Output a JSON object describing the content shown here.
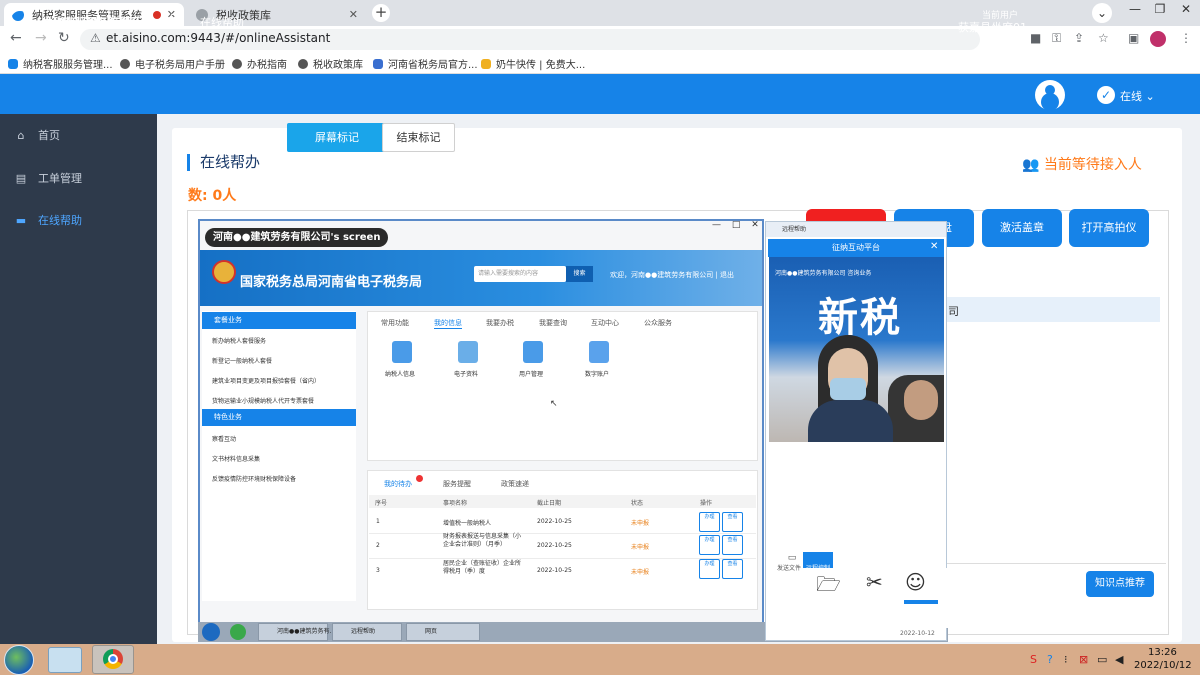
{
  "browser": {
    "tabs": [
      {
        "label": "纳税客服服务管理系统",
        "active": true
      },
      {
        "label": "税收政策库",
        "active": false
      }
    ],
    "url": "et.aisino.com:9443/#/onlineAssistant",
    "bookmarks": [
      "纳税客服服务管理...",
      "电子税务局用户手册",
      "办税指南",
      "税收政策库",
      "河南省税务局官方...",
      "奶牛快传 | 免费大..."
    ]
  },
  "app": {
    "title": "纳税客服服务管理系统",
    "breadcrumb": "在线帮助",
    "current_user_label": "当前用户",
    "current_user": "获嘉县坐席01",
    "status": "在线",
    "accent": "#1683e8"
  },
  "sidebar": {
    "items": [
      {
        "label": "首页",
        "icon": "home-icon",
        "active": false
      },
      {
        "label": "工单管理",
        "icon": "clipboard-icon",
        "active": false
      },
      {
        "label": "在线帮助",
        "icon": "chat-icon",
        "active": true
      }
    ]
  },
  "main": {
    "btn_mark": "屏幕标记",
    "btn_end_mark": "结束标记",
    "section_title": "在线帮办",
    "waiting_label": "当前等待接入人",
    "waiting_count": "数: 0人",
    "actions": [
      "激活盖章",
      "打开高拍仪"
    ],
    "action_partial": "盘",
    "right_list_item": "司",
    "knowledge_btn": "知识点推荐"
  },
  "shared_screen": {
    "title": "河南●●建筑劳务有限公司's screen",
    "window_buttons": "— □ ✕",
    "portal_title": "国家税务总局河南省电子税务局",
    "search_placeholder": "请输入需要搜索的内容",
    "search_button": "搜索",
    "welcome": "欢迎，河南●●建筑劳务有限公司 | 退出",
    "left_menu": {
      "group1": "套餐业务",
      "group1_items": [
        "新办纳税人套餐服务",
        "新登记一般纳税人套餐",
        "建筑业项目变更及项目报验套餐（省内）",
        "货物运输业小规模纳税人代开专票套餐"
      ],
      "group2": "特色业务",
      "group2_items": [
        "察看互动",
        "文书材料信息采集",
        "反馈疫情防控环境财税保障设备"
      ]
    },
    "tabs": [
      "常用功能",
      "我的信息",
      "我要办税",
      "我要查询",
      "互动中心",
      "公众服务"
    ],
    "services": [
      "纳税人信息",
      "电子资料",
      "用户管理",
      "数字账户"
    ],
    "todo_tabs": [
      "我的待办",
      "服务提醒",
      "政策速递"
    ],
    "table": {
      "headers": [
        "序号",
        "事项名称",
        "截止日期",
        "状态",
        "操作"
      ],
      "rows": [
        {
          "no": "1",
          "name": "增值税一般纳税人",
          "date": "2022-10-25",
          "status": "未申报"
        },
        {
          "no": "2",
          "name": "财务报表报送与信息采集（小企业会计准则）（月季）",
          "date": "2022-10-25",
          "status": "未申报"
        },
        {
          "no": "3",
          "name": "居民企业（查账征收）企业所得税月（季）度",
          "date": "2022-10-25",
          "status": "未申报"
        }
      ],
      "op_labels": [
        "办理",
        "查看"
      ]
    },
    "inner_taskbar": [
      "河南●●建筑劳务有...",
      "远程帮助",
      "网页"
    ]
  },
  "video_chat": {
    "window_title": "远程帮助",
    "header": "征纳互动平台",
    "banner_text": "新税",
    "banner_sub": "河南●●建筑劳务有限公司  咨询业务",
    "side_tabs": [
      "发送文件",
      "远程控制"
    ],
    "tool_icons": [
      "folder-icon",
      "scissors-icon",
      "emoji-icon"
    ],
    "footer": "2022-10-12"
  },
  "os": {
    "time": "13:26",
    "date": "2022/10/12"
  }
}
